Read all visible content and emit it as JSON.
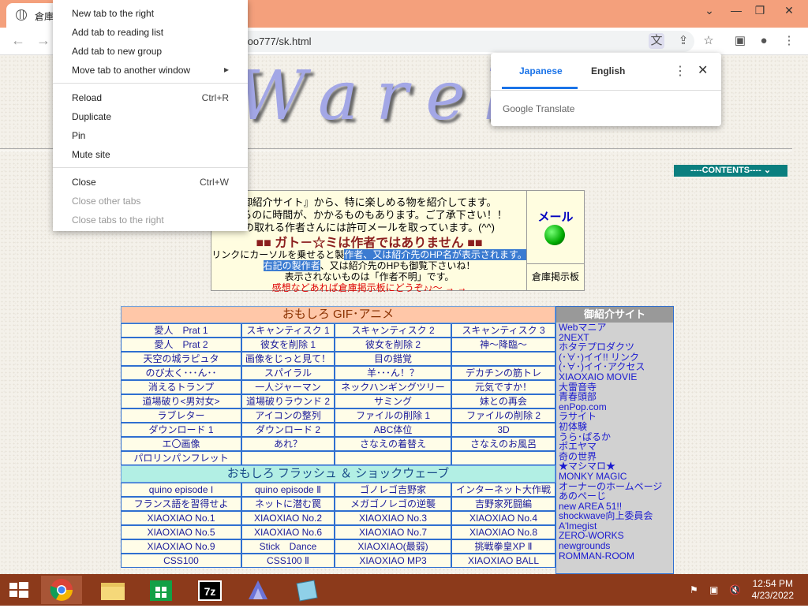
{
  "browser": {
    "tab_title": "倉庫",
    "url": "too777/sk.html",
    "win_min": "⌄",
    "win_minimize": "—",
    "win_restore": "❐",
    "win_close": "✕"
  },
  "context_menu": {
    "items": [
      {
        "label": "New tab to the right",
        "shortcut": ""
      },
      {
        "label": "Add tab to reading list",
        "shortcut": ""
      },
      {
        "label": "Add tab to new group",
        "shortcut": ""
      },
      {
        "label": "Move tab to another window",
        "shortcut": "▸"
      },
      {
        "label": "Reload",
        "shortcut": "Ctrl+R"
      },
      {
        "label": "Duplicate",
        "shortcut": ""
      },
      {
        "label": "Pin",
        "shortcut": ""
      },
      {
        "label": "Mute site",
        "shortcut": ""
      },
      {
        "label": "Close",
        "shortcut": "Ctrl+W"
      },
      {
        "label": "Close other tabs",
        "shortcut": "",
        "disabled": true
      },
      {
        "label": "Close tabs to the right",
        "shortcut": "",
        "disabled": true
      }
    ]
  },
  "translate": {
    "lang_source": "Japanese",
    "lang_target": "English",
    "brand": "Google Translate"
  },
  "page": {
    "logo": "Warehou",
    "contents_select": "----CONTENTS---- ⌄",
    "intro": {
      "line1": "御紹介サイト』から、特に楽しめる物を紹介してます。",
      "line2": "見るのに時間が、かかるものもあります。ご了承下さい！！",
      "line3": "の取れる作者さんには許可メールを取っています。(^^)",
      "line4": "■■ ガト－☆ミは作者ではありません ■■",
      "line5a": "リンクにカーソルを乗せると製",
      "line5b": "作者、又は紹介先のHP名が表示されます。",
      "line6a": "右記の製作者",
      "line6b": "、又は紹介先のHPも御覧下さいね！",
      "line7": "表示されないものは「作者不明」です。",
      "line8": "感想などあれば倉庫掲示板にどうぞ♪♪～ → →"
    },
    "mail_label": "メール",
    "bbs_label": "倉庫掲示板",
    "section1": "おもしろ GIF･アニメ",
    "section1_rows": [
      [
        "愛人　Prat 1",
        "スキャンティスク 1",
        "スキャンティスク 2",
        "スキャンティスク 3"
      ],
      [
        "愛人　Prat 2",
        "彼女を削除 1",
        "彼女を削除 2",
        "神～降臨～"
      ],
      [
        "天空の城ラピュタ",
        "画像をじっと見て！",
        "目の錯覚",
        ""
      ],
      [
        "のび太く･･･ん･･",
        "スパイラル",
        "羊･･･ん！？",
        "デカチンの筋トレ"
      ],
      [
        "消えるトランプ",
        "一人ジャーマン",
        "ネックハンギングツリー",
        "元気ですか！"
      ],
      [
        "道場破り<男対女>",
        "道場破りラウンド 2",
        "サミング",
        "妹との再会"
      ],
      [
        "ラブレター",
        "アイコンの整列",
        "ファイルの削除 1",
        "ファイルの削除 2"
      ],
      [
        "ダウンロード 1",
        "ダウンロード 2",
        "ABC体位",
        "3D"
      ],
      [
        "エ〇画像",
        "あれ？",
        "さなえの着替え",
        "さなえのお風呂"
      ],
      [
        "パロリンパンフレット",
        "",
        "",
        ""
      ]
    ],
    "section2": "おもしろ フラッシュ ＆ ショックウェーブ",
    "section2_rows": [
      [
        "quino episode I",
        "quino episode Ⅱ",
        "ゴノレゴ吉野家",
        "インターネット大作戦"
      ],
      [
        "フランス語を習得せよ",
        "ネットに潜む罠",
        "メガゴノレゴの逆襲",
        "吉野家死闘編"
      ],
      [
        "XIAOXIAO No.1",
        "XIAOXIAO No.2",
        "XIAOXIAO No.3",
        "XIAOXIAO No.4"
      ],
      [
        "XIAOXIAO No.5",
        "XIAOXIAO No.6",
        "XIAOXIAO No.7",
        "XIAOXIAO No.8"
      ],
      [
        "XIAOXIAO No.9",
        "Stick　Dance",
        "XIAOXIAO(最弱)",
        "挑戦拳皇XP Ⅱ"
      ],
      [
        "CSS100",
        "CSS100 Ⅱ",
        "XIAOXIAO MP3",
        "XIAOXIAO BALL"
      ]
    ],
    "side_header": "御紹介サイト",
    "side_links": [
      "Webマニア",
      "2NEXT",
      "ホタテプロダクツ",
      "(･∀･)イイ!! リンク",
      "(･∀･)イイ･アクセス",
      "XIAOXAIO MOVIE",
      "大雷音寺",
      "青春頭部",
      "enPop.com",
      "ラサイト",
      "初体験",
      "うら･ぱるか",
      "ポエヤマ",
      "奇の世界",
      "★マシマロ★",
      "MONKY MAGIC",
      "オーナーのホームページ",
      "あのぺーじ",
      "new AREA 51!!",
      "shockwave向上委員会",
      "A'lmegist",
      "ZERO-WORKS",
      "newgrounds",
      "ROMMAN-ROOM"
    ]
  },
  "taskbar": {
    "time": "12:54 PM",
    "date": "4/23/2022"
  }
}
